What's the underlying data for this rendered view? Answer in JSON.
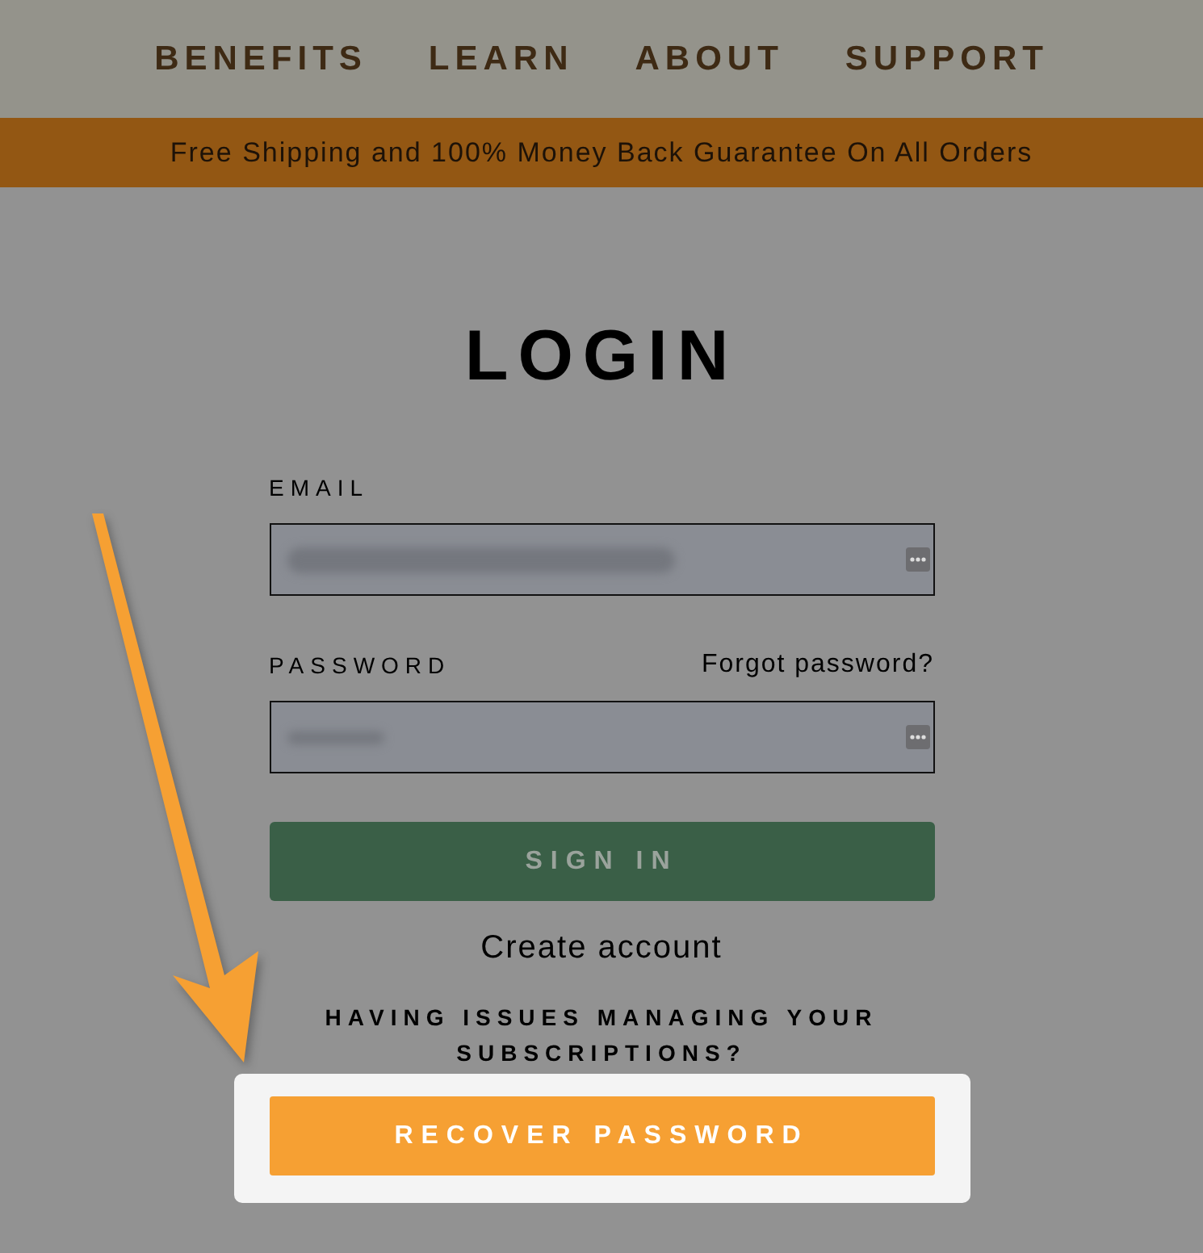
{
  "nav": {
    "items": [
      "BENEFITS",
      "LEARN",
      "ABOUT",
      "SUPPORT"
    ]
  },
  "banner": {
    "text": "Free Shipping and 100% Money Back Guarantee On All Orders"
  },
  "login": {
    "title": "LOGIN",
    "fields": [
      {
        "label": "EMAIL",
        "redacted": true,
        "kind": "email"
      },
      {
        "label": "PASSWORD",
        "link": "Forgot password?",
        "redacted": true,
        "kind": "password"
      }
    ],
    "submit": "SIGN IN",
    "create_account": "Create account",
    "issues_text": "HAVING ISSUES MANAGING YOUR SUBSCRIPTIONS?",
    "recover_button": "RECOVER PASSWORD",
    "highlighted": true
  }
}
